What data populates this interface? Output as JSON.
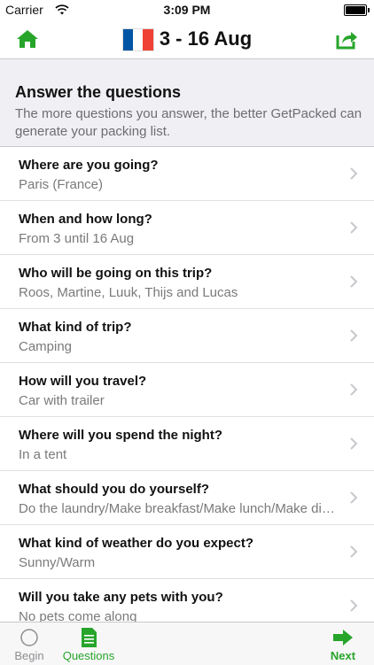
{
  "status": {
    "carrier": "Carrier",
    "time": "3:09 PM"
  },
  "nav": {
    "title": "3 - 16 Aug",
    "flag_colors": [
      "#0055A4",
      "#FFFFFF",
      "#EF4135"
    ],
    "accent": "#27a52b"
  },
  "section": {
    "heading": "Answer the questions",
    "description": "The more questions you answer, the better GetPacked can generate your packing list."
  },
  "questions": [
    {
      "q": "Where are you going?",
      "a": "Paris (France)"
    },
    {
      "q": "When and how long?",
      "a": "From 3 until 16 Aug"
    },
    {
      "q": "Who will be going on this trip?",
      "a": "Roos, Martine, Luuk, Thijs and Lucas"
    },
    {
      "q": "What kind of trip?",
      "a": "Camping"
    },
    {
      "q": "How will you travel?",
      "a": "Car with trailer"
    },
    {
      "q": "Where will you spend the night?",
      "a": "In a tent"
    },
    {
      "q": "What should you do yourself?",
      "a": "Do the laundry/Make breakfast/Make lunch/Make dinner"
    },
    {
      "q": "What kind of weather do you expect?",
      "a": "Sunny/Warm"
    },
    {
      "q": "Will you take any pets with you?",
      "a": "No pets come along"
    }
  ],
  "tabs": {
    "begin": "Begin",
    "questions": "Questions",
    "next": "Next"
  }
}
